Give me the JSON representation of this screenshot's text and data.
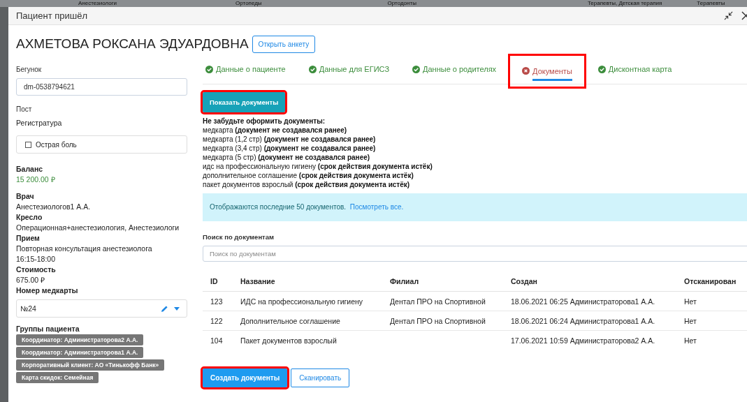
{
  "background_headers": [
    "Анестезиологи",
    "Ортопеды",
    "Ортодонты",
    "Терапевты, Детская терапия",
    "Терапевты"
  ],
  "window": {
    "title": "Пациент пришёл"
  },
  "patient": {
    "name": "АХМЕТОВА РОКСАНА ЭДУАРДОВНА",
    "open_form_button": "Открыть анкету"
  },
  "sidebar": {
    "runner": {
      "label": "Бегунок",
      "value": "dm-0538794621"
    },
    "post": {
      "label": "Пост",
      "value": "Регистратура"
    },
    "acute_pain": {
      "label": "Острая боль",
      "checked": false
    },
    "balance": {
      "label": "Баланс",
      "value": "15 200.00 ₽"
    },
    "fields": [
      {
        "label": "Врач",
        "lines": [
          "Анестезиологов1 А.А."
        ]
      },
      {
        "label": "Кресло",
        "lines": [
          "Операционная+анестезиология, Анестезиологи"
        ]
      },
      {
        "label": "Прием",
        "lines": [
          "Повторная консультация анестезиолога",
          "16:15-18:00"
        ]
      },
      {
        "label": "Стоимость",
        "lines": [
          "675.00 ₽"
        ]
      }
    ],
    "card_number": {
      "label": "Номер медкарты",
      "value": "№24"
    },
    "groups": {
      "label": "Группы пациента",
      "tags": [
        "Координатор: Администраторова2 А.А.",
        "Координатор: Администраторова1 А.А.",
        "Корпоративный клиент: АО «Тинькофф Банк»",
        "Карта скидок: Семейная"
      ]
    }
  },
  "tabs": [
    {
      "label": "Данные о пациенте",
      "complete": true,
      "selected": false,
      "highlighted": false
    },
    {
      "label": "Данные для ЕГИСЗ",
      "complete": true,
      "selected": false,
      "highlighted": false
    },
    {
      "label": "Данные о родителях",
      "complete": true,
      "selected": false,
      "highlighted": false
    },
    {
      "label": "Документы",
      "complete": false,
      "selected": true,
      "highlighted": true
    },
    {
      "label": "Дисконтная карта",
      "complete": true,
      "selected": false,
      "highlighted": false
    }
  ],
  "show_documents_button": {
    "label": "Показать документы",
    "highlighted": true
  },
  "reminder": {
    "title": "Не забудьте оформить документы:",
    "items": [
      "медкарта **(документ не создавался ранее)**",
      "медкарта (1,2 стр) **(документ не создавался ранее)**",
      "медкарта (3,4 стр) **(документ не создавался ранее)**",
      "медкарта (5 стр) **(документ не создавался ранее)**",
      "идс на профессиональную гигиену **(срок действия документа истёк)**",
      "дополнительное соглашение **(срок действия документа истёк)**",
      "пакет документов взрослый **(срок действия документа истёк)**"
    ]
  },
  "info": {
    "text": "Отображаются последние 50 документов.",
    "link": "Посмотреть все."
  },
  "search": {
    "label": "Поиск по документам",
    "placeholder": "Поиск по документам"
  },
  "table": {
    "columns": [
      "ID",
      "Название",
      "Филиал",
      "Создан",
      "Отсканирован"
    ],
    "rows": [
      [
        "123",
        "ИДС на профессиональную гигиену",
        "Дентал ПРО на Спортивной",
        "18.06.2021 06:25 Администраторова1 А.А.",
        "Нет"
      ],
      [
        "122",
        "Дополнительное соглашение",
        "Дентал ПРО на Спортивной",
        "18.06.2021 06:24 Администраторова1 А.А.",
        "Нет"
      ],
      [
        "104",
        "Пакет документов взрослый",
        "",
        "17.06.2021 10:59 Администраторова2 А.А.",
        "Нет"
      ]
    ]
  },
  "actions": [
    {
      "label": "Создать документы",
      "kind": "primary",
      "highlighted": true
    },
    {
      "label": "Сканировать",
      "kind": "outline",
      "highlighted": false
    }
  ]
}
